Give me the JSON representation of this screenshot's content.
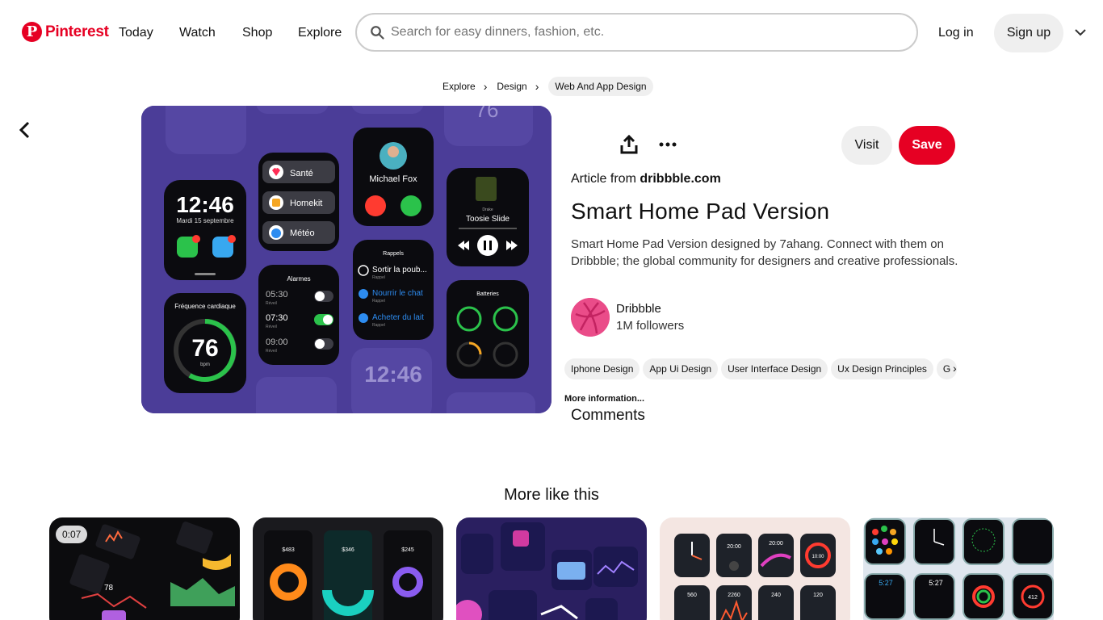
{
  "header": {
    "logo": "Pinterest",
    "nav": [
      "Today",
      "Watch",
      "Shop",
      "Explore"
    ],
    "search_placeholder": "Search for easy dinners, fashion, etc.",
    "login": "Log in",
    "signup": "Sign up"
  },
  "breadcrumb": [
    "Explore",
    "Design",
    "Web And App Design"
  ],
  "pin": {
    "visit": "Visit",
    "save": "Save",
    "article_from_prefix": "Article from ",
    "article_from_domain": "dribbble.com",
    "title": "Smart Home Pad Version",
    "description": "Smart Home Pad Version designed by 7ahang. Connect with them on Dribbble; the global community for designers and creative professionals.",
    "creator_name": "Dribbble",
    "creator_followers": "1M followers",
    "tags": [
      "Iphone Design",
      "App Ui Design",
      "User Interface Design",
      "Ux Design Principles",
      "G"
    ],
    "more_info": "More information...",
    "comments": "Comments"
  },
  "image_text": {
    "time": "12:46",
    "date": "Mardi 15 septembre",
    "sante": "Santé",
    "homekit": "Homekit",
    "meteo": "Météo",
    "caller": "Michael Fox",
    "artist": "Drake",
    "song": "Toosie Slide",
    "heart_title": "Fréquence cardiaque",
    "heart_value": "76",
    "heart_unit": "bpm",
    "alarms_title": "Alarmes",
    "alarm1": "05:30",
    "alarm2": "07:30",
    "alarm3": "09:00",
    "alarm_sub": "Réveil",
    "rappels_title": "Rappels",
    "rappel1": "Sortir la poub...",
    "rappel2": "Nourrir le chat",
    "rappel3": "Acheter du lait",
    "rappel_sub": "Rappel",
    "batteries_title": "Batteries",
    "big_bg_time": "12:46",
    "top_76": "76"
  },
  "more_like_this": {
    "title": "More like this",
    "video_duration": "0:07"
  }
}
